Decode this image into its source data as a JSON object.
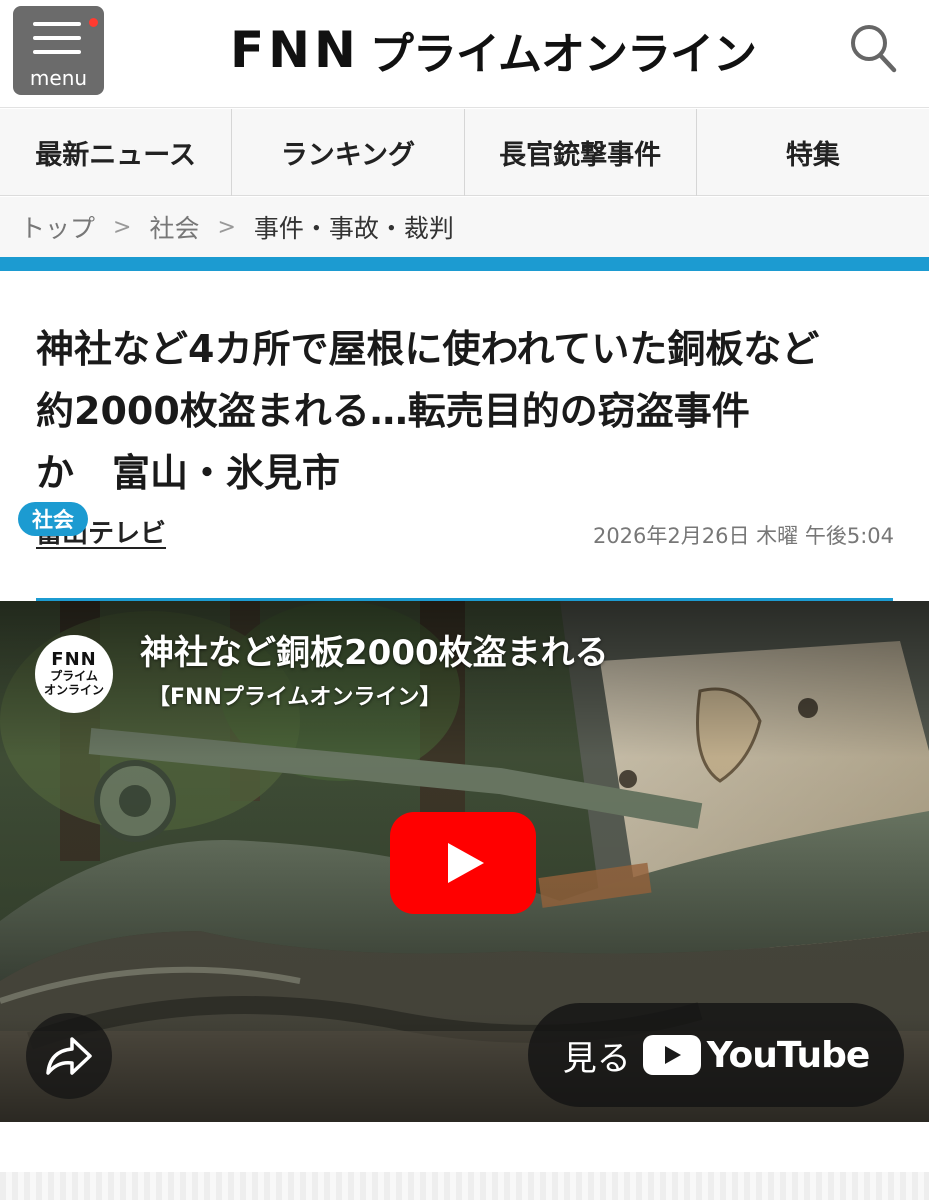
{
  "header": {
    "menu_label": "menu",
    "logo_fnn": "FNN",
    "logo_jp": "プライムオンライン"
  },
  "nav": {
    "tabs": [
      {
        "label": "最新ニュース"
      },
      {
        "label": "ランキング"
      },
      {
        "label": "長官銃撃事件"
      },
      {
        "label": "特集"
      }
    ]
  },
  "breadcrumb": {
    "items": [
      "トップ",
      "社会",
      "事件・事故・裁判"
    ],
    "separator": ">"
  },
  "article": {
    "headline_lines": [
      "神社など4カ所で屋根に使われていた銅板など",
      "約2000枚盗まれる…転売目的の窃盗事件",
      "か　富山・氷見市"
    ],
    "source": "富山テレビ",
    "date": "2026年2月26日 木曜 午後5:04"
  },
  "video": {
    "channel_logo_line1": "FNN",
    "channel_logo_line2": "プライム",
    "channel_logo_line3": "オンライン",
    "title": "神社など銅板2000枚盗まれる",
    "channel": "【FNNプライムオンライン】",
    "watch_label": "見る",
    "youtube_label": "YouTube",
    "tag": "社会"
  },
  "colors": {
    "accent": "#1c9bd1",
    "menu_bg": "#6b6b6b",
    "youtube_red": "#ff0000"
  }
}
